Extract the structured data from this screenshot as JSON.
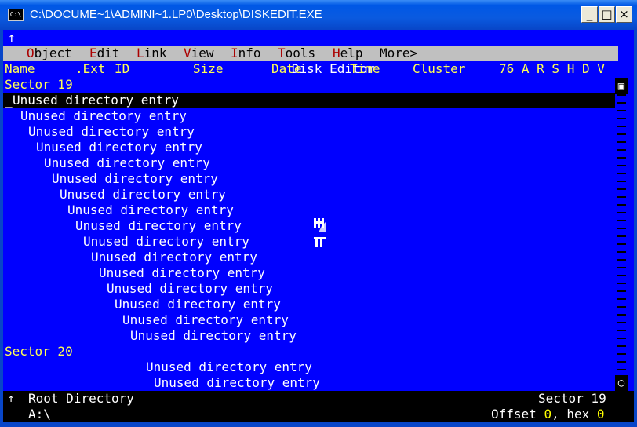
{
  "window": {
    "title": "C:\\DOCUME~1\\ADMINI~1.LP0\\Desktop\\DISKEDIT.EXE",
    "icon": "console-icon",
    "minimize_label": "_",
    "maximize_label": "□",
    "close_label": "×"
  },
  "app": {
    "title": "Disk Editor",
    "menu_corner": "↑"
  },
  "menu": [
    {
      "hot": "O",
      "rest": "bject"
    },
    {
      "hot": "E",
      "rest": "dit"
    },
    {
      "hot": "L",
      "rest": "ink"
    },
    {
      "hot": "V",
      "rest": "iew"
    },
    {
      "hot": "I",
      "rest": "nfo"
    },
    {
      "hot": "T",
      "rest": "ools"
    },
    {
      "hot": "H",
      "rest": "elp"
    },
    {
      "hot": "",
      "rest": "More>"
    }
  ],
  "columns": {
    "name": "Name",
    "ext": ".Ext",
    "id": "ID",
    "size": "Size",
    "date": "Date",
    "time": "Time",
    "cluster": "Cluster",
    "attrs": "76 A R S H D V"
  },
  "sector19": {
    "label": "Sector 19",
    "cursor": "_",
    "entries": [
      "Unused directory entry",
      "Unused directory entry",
      "Unused directory entry",
      "Unused directory entry",
      "Unused directory entry",
      "Unused directory entry",
      "Unused directory entry",
      "Unused directory entry",
      "Unused directory entry",
      "Unused directory entry",
      "Unused directory entry",
      "Unused directory entry",
      "Unused directory entry",
      "Unused directory entry",
      "Unused directory entry",
      "Unused directory entry"
    ]
  },
  "sector20": {
    "label": "Sector 20",
    "entries": [
      "Unused directory entry",
      "Unused directory entry"
    ]
  },
  "status": {
    "corner": "↑",
    "object": "Root Directory",
    "path": "A:\\",
    "sector": "Sector 19",
    "offset_label": "Offset ",
    "offset_value": "0",
    "hex_label": ", hex ",
    "hex_value": "0"
  },
  "colors": {
    "background": "#0000ff",
    "highlight": "#ffff55",
    "menu_bar": "#c0c0c0",
    "hotkey": "#aa0000"
  }
}
